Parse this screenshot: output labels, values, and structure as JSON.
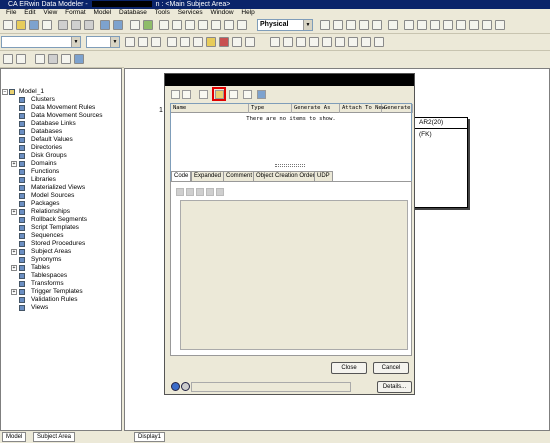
{
  "window": {
    "title_prefix": "CA ERwin Data Modeler -",
    "title_suffix": "n : <Main Subject Area>"
  },
  "menu": [
    "File",
    "Edit",
    "View",
    "Format",
    "Model",
    "Database",
    "Tools",
    "Services",
    "Window",
    "Help"
  ],
  "toolbar": {
    "model_type": "Physical"
  },
  "tree": {
    "root": "Model_1",
    "items": [
      {
        "label": "Clusters",
        "expandable": false
      },
      {
        "label": "Data Movement Rules",
        "expandable": false
      },
      {
        "label": "Data Movement Sources",
        "expandable": false
      },
      {
        "label": "Database Links",
        "expandable": false
      },
      {
        "label": "Databases",
        "expandable": false
      },
      {
        "label": "Default Values",
        "expandable": false
      },
      {
        "label": "Directories",
        "expandable": false
      },
      {
        "label": "Disk Groups",
        "expandable": false
      },
      {
        "label": "Domains",
        "expandable": true
      },
      {
        "label": "Functions",
        "expandable": false
      },
      {
        "label": "Libraries",
        "expandable": false
      },
      {
        "label": "Materialized Views",
        "expandable": false
      },
      {
        "label": "Model Sources",
        "expandable": false
      },
      {
        "label": "Packages",
        "expandable": false
      },
      {
        "label": "Relationships",
        "expandable": true
      },
      {
        "label": "Rollback Segments",
        "expandable": false
      },
      {
        "label": "Script Templates",
        "expandable": false
      },
      {
        "label": "Sequences",
        "expandable": false
      },
      {
        "label": "Stored Procedures",
        "expandable": false
      },
      {
        "label": "Subject Areas",
        "expandable": true
      },
      {
        "label": "Synonyms",
        "expandable": false
      },
      {
        "label": "Tables",
        "expandable": true
      },
      {
        "label": "Tablespaces",
        "expandable": false
      },
      {
        "label": "Transforms",
        "expandable": false
      },
      {
        "label": "Trigger Templates",
        "expandable": true
      },
      {
        "label": "Validation Rules",
        "expandable": false
      },
      {
        "label": "Views",
        "expandable": false
      }
    ]
  },
  "left_tabs": [
    "Model",
    "Subject Area"
  ],
  "canvas": {
    "entity_label_1": "AR2(20)",
    "entity_label_2": "(FK)",
    "entity_number": "1",
    "tab": "Display1"
  },
  "dialog": {
    "grid_columns": [
      "Name",
      "Type",
      "Generate As",
      "Attach To New",
      "Generate"
    ],
    "grid_empty": "There are no items to show.",
    "tabs": [
      "Code",
      "Expanded",
      "Comment",
      "Object Creation Order",
      "UDP"
    ],
    "active_tab": "Code",
    "close_label": "Close",
    "cancel_label": "Cancel",
    "details_label": "Details..."
  }
}
